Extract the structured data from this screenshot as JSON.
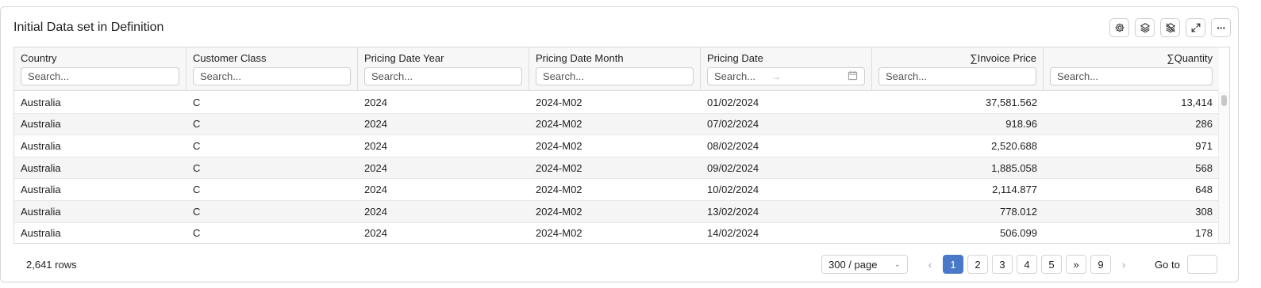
{
  "panel": {
    "title": "Initial Data set in Definition",
    "toolbar": [
      {
        "name": "settings-icon"
      },
      {
        "name": "layers-icon"
      },
      {
        "name": "layers-off-icon"
      },
      {
        "name": "expand-icon"
      },
      {
        "name": "more-icon",
        "glyph": "···"
      }
    ]
  },
  "grid": {
    "columns": [
      {
        "label": "Country",
        "placeholder": "Search...",
        "align": "left"
      },
      {
        "label": "Customer Class",
        "placeholder": "Search...",
        "align": "left"
      },
      {
        "label": "Pricing Date Year",
        "placeholder": "Search...",
        "align": "left"
      },
      {
        "label": "Pricing Date Month",
        "placeholder": "Search...",
        "align": "left"
      },
      {
        "label": "Pricing Date",
        "placeholder": "Search...",
        "align": "left",
        "range": true,
        "range_arrow": "→"
      },
      {
        "label": "∑Invoice Price",
        "placeholder": "Search...",
        "align": "right"
      },
      {
        "label": "∑Quantity",
        "placeholder": "Search...",
        "align": "right"
      }
    ],
    "rows": [
      [
        "Australia",
        "C",
        "2024",
        "2024-M02",
        "01/02/2024",
        "37,581.562",
        "13,414"
      ],
      [
        "Australia",
        "C",
        "2024",
        "2024-M02",
        "07/02/2024",
        "918.96",
        "286"
      ],
      [
        "Australia",
        "C",
        "2024",
        "2024-M02",
        "08/02/2024",
        "2,520.688",
        "971"
      ],
      [
        "Australia",
        "C",
        "2024",
        "2024-M02",
        "09/02/2024",
        "1,885.058",
        "568"
      ],
      [
        "Australia",
        "C",
        "2024",
        "2024-M02",
        "10/02/2024",
        "2,114.877",
        "648"
      ],
      [
        "Australia",
        "C",
        "2024",
        "2024-M02",
        "13/02/2024",
        "778.012",
        "308"
      ],
      [
        "Australia",
        "C",
        "2024",
        "2024-M02",
        "14/02/2024",
        "506.099",
        "178"
      ]
    ]
  },
  "footer": {
    "row_count": "2,641 rows",
    "page_size": "300 / page",
    "prev": "‹",
    "pages": [
      "1",
      "2",
      "3",
      "4",
      "5",
      "»",
      "9"
    ],
    "active_page": "1",
    "next": "›",
    "goto_label": "Go to"
  },
  "colors": {
    "accent": "#4a78c8",
    "alt_row": "#f5f5f5",
    "header_bg": "#f7f7f7"
  }
}
